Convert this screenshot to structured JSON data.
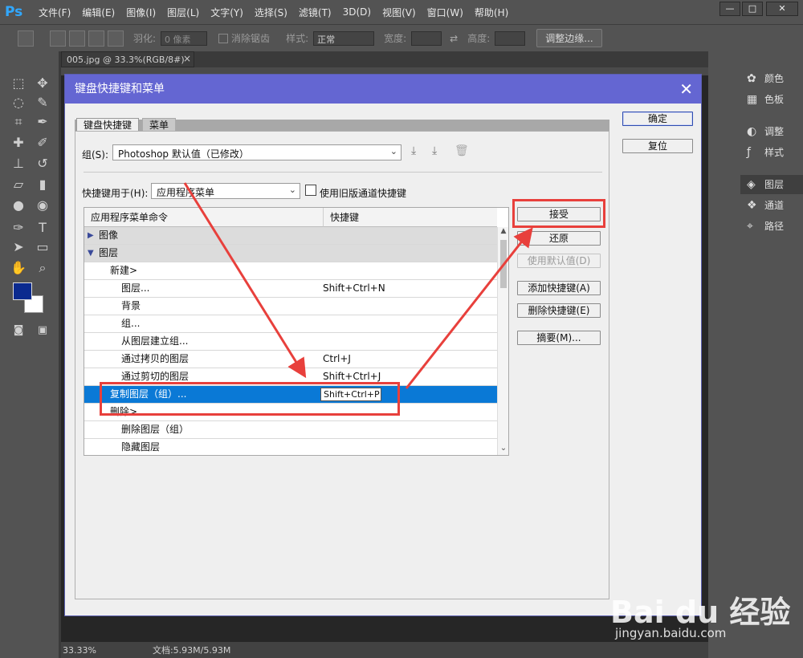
{
  "app": {
    "logo": "Ps"
  },
  "menubar": {
    "items": [
      "文件(F)",
      "编辑(E)",
      "图像(I)",
      "图层(L)",
      "文字(Y)",
      "选择(S)",
      "滤镜(T)",
      "3D(D)",
      "视图(V)",
      "窗口(W)",
      "帮助(H)"
    ],
    "window_controls": {
      "minimize": "—",
      "maximize": "□",
      "close": "✕"
    }
  },
  "options_bar": {
    "feather_label": "羽化:",
    "feather_value": "0 像素",
    "antialias_label": "消除锯齿",
    "style_label": "样式:",
    "style_value": "正常",
    "width_label": "宽度:",
    "height_label": "高度:",
    "refine_edge_button": "调整边缘..."
  },
  "document": {
    "tab_title": "005.jpg @ 33.3%(RGB/8#)",
    "tab_close": "×",
    "zoom": "33.33%",
    "doc_info": "文档:5.93M/5.93M"
  },
  "right_panels": {
    "items": [
      {
        "label": "颜色",
        "icon": "color-wheel-icon"
      },
      {
        "label": "色板",
        "icon": "swatches-icon"
      },
      {
        "label": "调整",
        "icon": "adjustments-icon"
      },
      {
        "label": "样式",
        "icon": "styles-icon"
      },
      {
        "label": "图层",
        "icon": "layers-icon"
      },
      {
        "label": "通道",
        "icon": "channels-icon"
      },
      {
        "label": "路径",
        "icon": "paths-icon"
      }
    ]
  },
  "dialog": {
    "title": "键盘快捷键和菜单",
    "close": "✕",
    "tabs": {
      "shortcuts": "键盘快捷键",
      "menus": "菜单"
    },
    "group_label": "组(S):",
    "group_value": "Photoshop 默认值（已修改）",
    "shortcuts_for_label": "快捷键用于(H):",
    "shortcuts_for_value": "应用程序菜单",
    "legacy_channel_label": "使用旧版通道快捷键",
    "table": {
      "col_command": "应用程序菜单命令",
      "col_shortcut": "快捷键",
      "rows": [
        {
          "name": "图像",
          "key": "",
          "type": "group",
          "expanded": false
        },
        {
          "name": "图层",
          "key": "",
          "type": "group",
          "expanded": true
        },
        {
          "name": "新建>",
          "key": "",
          "type": "sub"
        },
        {
          "name": "图层...",
          "key": "Shift+Ctrl+N",
          "type": "item"
        },
        {
          "name": "背景",
          "key": "",
          "type": "item"
        },
        {
          "name": "组...",
          "key": "",
          "type": "item"
        },
        {
          "name": "从图层建立组...",
          "key": "",
          "type": "item"
        },
        {
          "name": "通过拷贝的图层",
          "key": "Ctrl+J",
          "type": "item"
        },
        {
          "name": "通过剪切的图层",
          "key": "Shift+Ctrl+J",
          "type": "item"
        },
        {
          "name": "复制图层（组）...",
          "key": "Shift+Ctrl+P",
          "type": "selected"
        },
        {
          "name": "删除>",
          "key": "",
          "type": "sub"
        },
        {
          "name": "删除图层（组）",
          "key": "",
          "type": "item"
        },
        {
          "name": "隐藏图层",
          "key": "",
          "type": "item"
        }
      ]
    },
    "buttons": {
      "ok": "确定",
      "reset": "复位",
      "accept": "接受",
      "undo": "还原",
      "use_default": "使用默认值(D)",
      "add_shortcut": "添加快捷键(A)",
      "delete_shortcut": "删除快捷键(E)",
      "summarize": "摘要(M)..."
    }
  },
  "watermark": {
    "brand": "Bai du 经验",
    "url": "jingyan.baidu.com"
  },
  "colors": {
    "accent": "#6466d2",
    "selection": "#0a79d6",
    "annotation": "#e8403c",
    "foreground": "#0b2a8f",
    "background": "#ffffff"
  }
}
